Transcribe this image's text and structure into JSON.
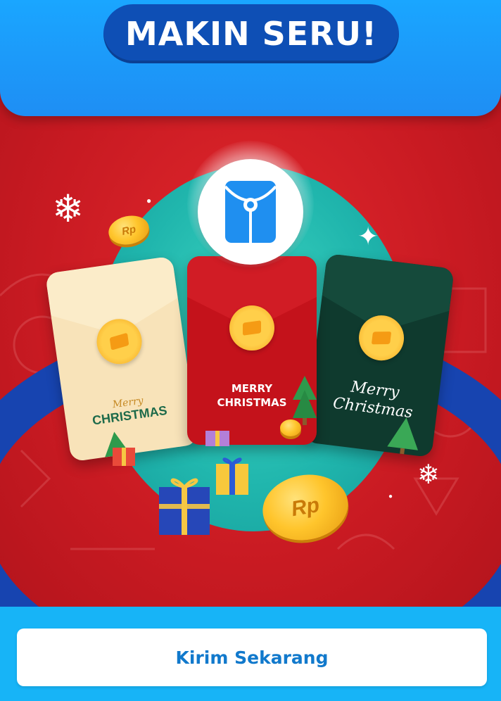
{
  "header": {
    "title": "MAKIN SERU!"
  },
  "illustration": {
    "center_icon": "envelope-icon",
    "cards": [
      {
        "theme": "cream",
        "greeting_script": "Merry",
        "greeting_main": "CHRISTMAS"
      },
      {
        "theme": "red",
        "greeting_line1": "MERRY",
        "greeting_line2": "CHRISTMAS"
      },
      {
        "theme": "green",
        "greeting_line1": "Merry",
        "greeting_line2": "Christmas"
      }
    ],
    "coin_label": "Rp",
    "colors": {
      "header_blue": "#1aa6ff",
      "title_pill": "#0e4fb5",
      "background_red": "#c81a22",
      "teal_disc": "#20b6ad",
      "ring_blue": "#1744b0",
      "cta_text": "#1179cc"
    }
  },
  "footer": {
    "cta_label": "Kirim Sekarang"
  }
}
